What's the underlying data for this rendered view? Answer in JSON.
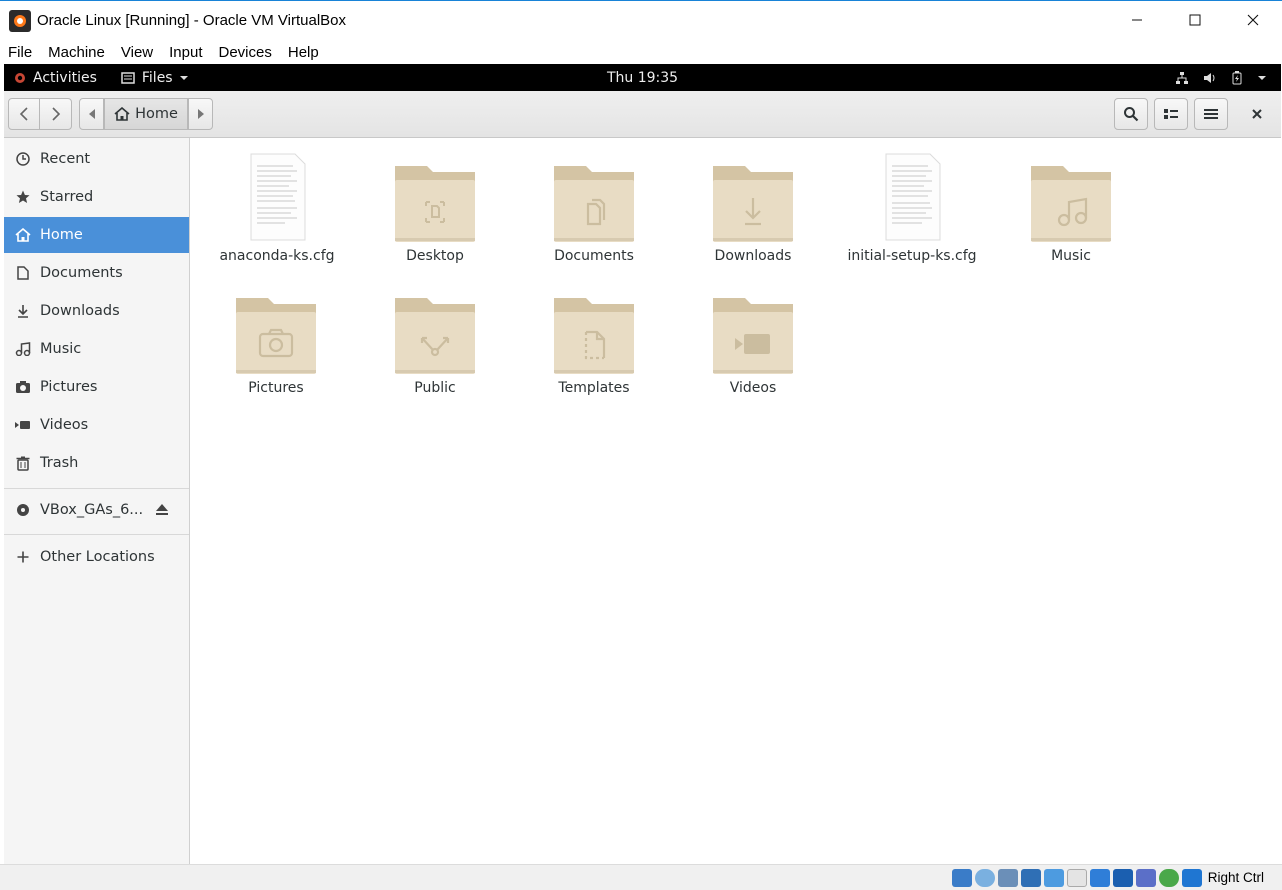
{
  "window": {
    "title": "Oracle Linux [Running] - Oracle VM VirtualBox",
    "controls": [
      "minimize",
      "maximize",
      "close"
    ]
  },
  "menubar": [
    "File",
    "Machine",
    "View",
    "Input",
    "Devices",
    "Help"
  ],
  "topbar": {
    "activities": "Activities",
    "app_menu": "Files",
    "clock": "Thu 19:35"
  },
  "headerbar": {
    "path_current": "Home"
  },
  "sidebar": {
    "items": [
      {
        "label": "Recent",
        "icon": "clock-icon"
      },
      {
        "label": "Starred",
        "icon": "star-icon"
      },
      {
        "label": "Home",
        "icon": "home-icon",
        "active": true
      },
      {
        "label": "Documents",
        "icon": "document-icon"
      },
      {
        "label": "Downloads",
        "icon": "download-icon"
      },
      {
        "label": "Music",
        "icon": "music-icon"
      },
      {
        "label": "Pictures",
        "icon": "camera-icon"
      },
      {
        "label": "Videos",
        "icon": "video-icon"
      },
      {
        "label": "Trash",
        "icon": "trash-icon"
      }
    ],
    "device": {
      "label": "VBox_GAs_6...",
      "icon": "disc-icon"
    },
    "other": {
      "label": "Other Locations",
      "icon": "plus-icon"
    }
  },
  "files": [
    {
      "name": "anaconda-ks.cfg",
      "kind": "text-file"
    },
    {
      "name": "Desktop",
      "kind": "folder",
      "emblem": "desktop"
    },
    {
      "name": "Documents",
      "kind": "folder",
      "emblem": "documents"
    },
    {
      "name": "Downloads",
      "kind": "folder",
      "emblem": "downloads"
    },
    {
      "name": "initial-setup-ks.cfg",
      "kind": "text-file"
    },
    {
      "name": "Music",
      "kind": "folder",
      "emblem": "music"
    },
    {
      "name": "Pictures",
      "kind": "folder",
      "emblem": "pictures"
    },
    {
      "name": "Public",
      "kind": "folder",
      "emblem": "public"
    },
    {
      "name": "Templates",
      "kind": "folder",
      "emblem": "templates"
    },
    {
      "name": "Videos",
      "kind": "folder",
      "emblem": "videos"
    }
  ],
  "statusbar": {
    "host_key": "Right Ctrl"
  },
  "colors": {
    "selection": "#4a90d9",
    "folder": "#e8dcc4",
    "folder_tab": "#d4c4a4",
    "topbar": "#000000"
  }
}
